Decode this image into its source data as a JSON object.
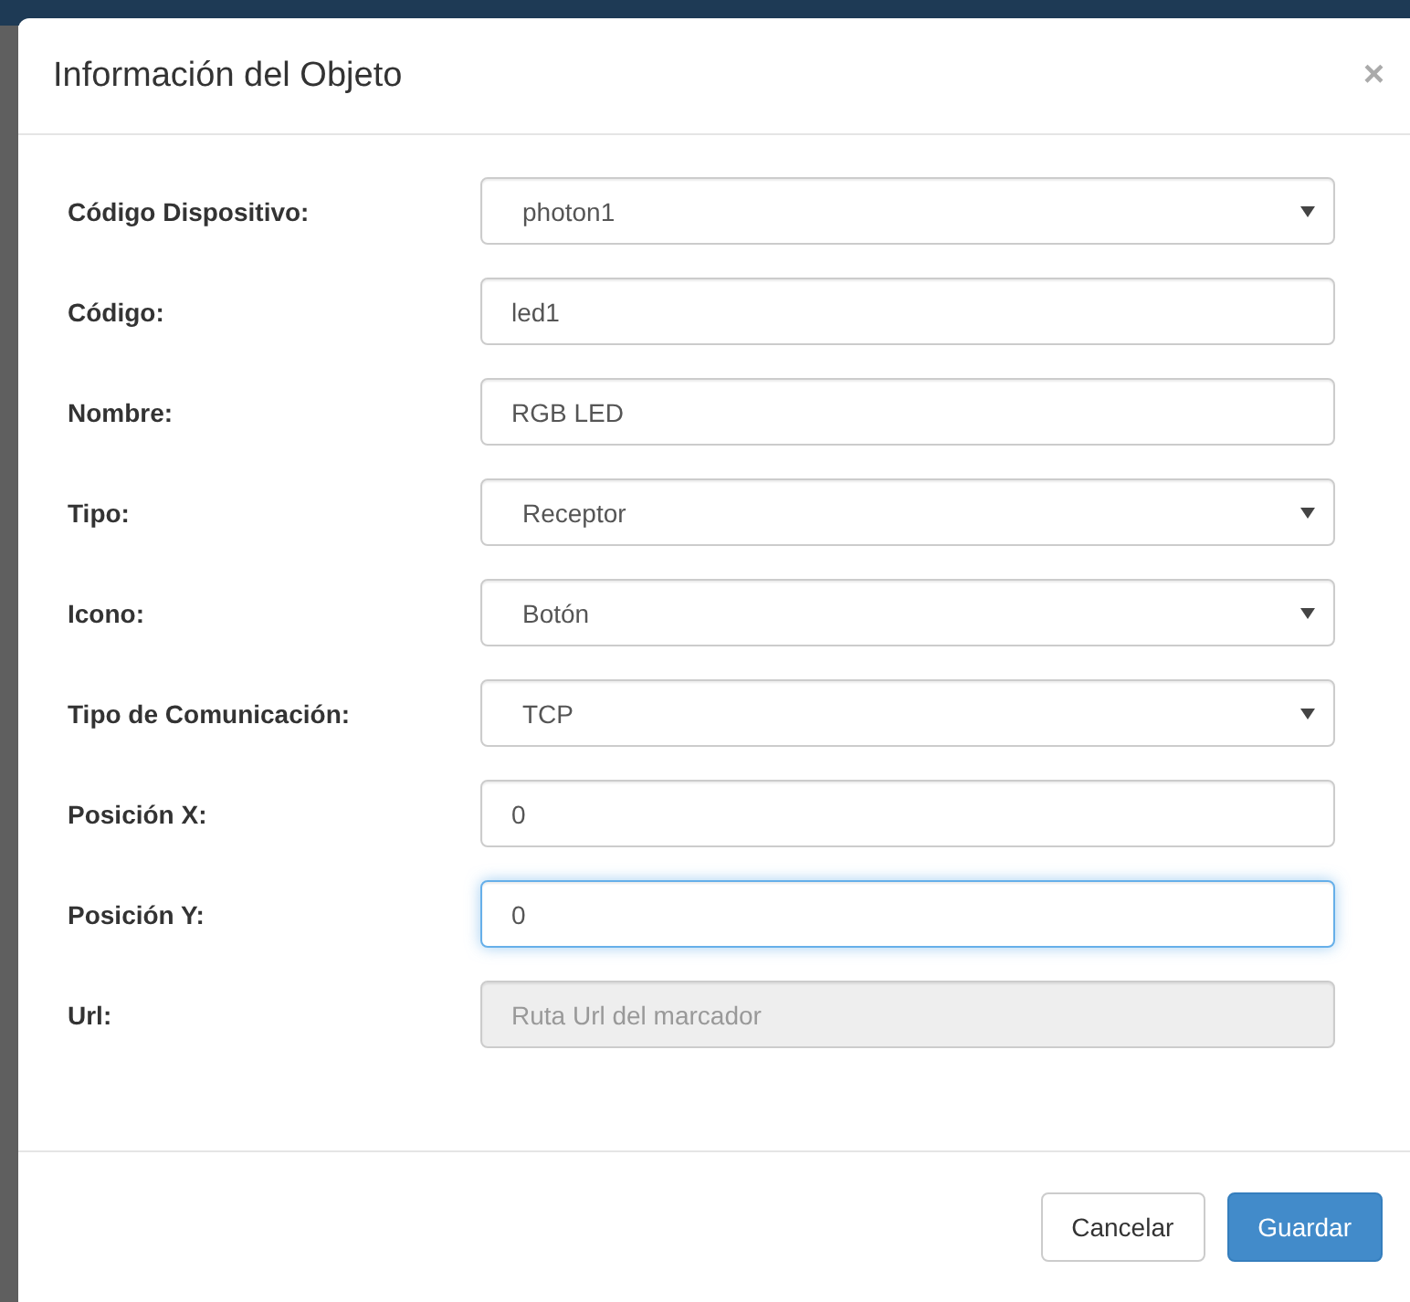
{
  "modal": {
    "title": "Información del Objeto",
    "close": "×"
  },
  "fields": [
    {
      "label": "Código Dispositivo:",
      "kind": "select",
      "value": "photon1",
      "focused": false,
      "disabled": false
    },
    {
      "label": "Código:",
      "kind": "input",
      "value": "led1",
      "focused": false,
      "disabled": false
    },
    {
      "label": "Nombre:",
      "kind": "input",
      "value": "RGB LED",
      "focused": false,
      "disabled": false
    },
    {
      "label": "Tipo:",
      "kind": "select",
      "value": "Receptor",
      "focused": false,
      "disabled": false
    },
    {
      "label": "Icono:",
      "kind": "select",
      "value": "Botón",
      "focused": false,
      "disabled": false
    },
    {
      "label": "Tipo de Comunicación:",
      "kind": "select",
      "value": "TCP",
      "focused": false,
      "disabled": false
    },
    {
      "label": "Posición X:",
      "kind": "input",
      "value": "0",
      "focused": false,
      "disabled": false
    },
    {
      "label": "Posición Y:",
      "kind": "input",
      "value": "0",
      "focused": true,
      "disabled": false
    },
    {
      "label": "Url:",
      "kind": "input",
      "placeholder": "Ruta Url del marcador",
      "focused": false,
      "disabled": true
    }
  ],
  "buttons": [
    {
      "label": "Cancelar",
      "kind": "default"
    },
    {
      "label": "Guardar",
      "kind": "primary"
    }
  ]
}
